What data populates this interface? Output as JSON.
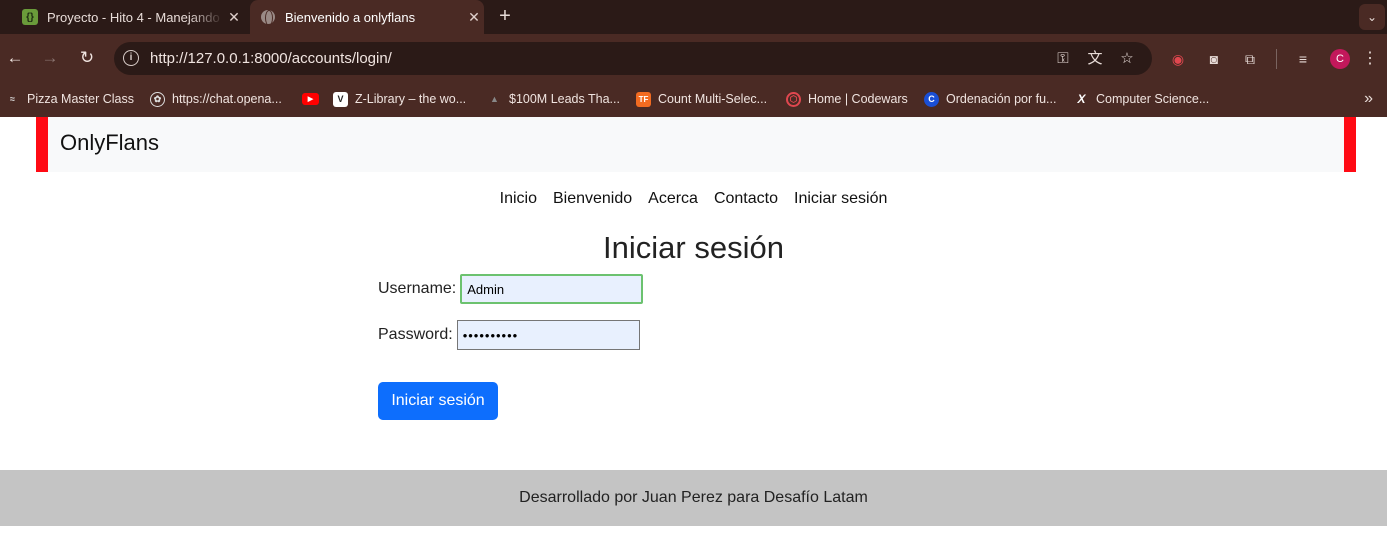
{
  "browser": {
    "tabs": [
      {
        "title": "Proyecto - Hito 4 - Manejando",
        "favicon": "{}",
        "active": false
      },
      {
        "title": "Bienvenido a onlyflans",
        "favicon": "globe-icon",
        "active": true
      }
    ],
    "url": "http://127.0.0.1:8000/accounts/login/",
    "bookmarks": [
      {
        "label": "Pizza Master Class",
        "icon": "pizza-icon"
      },
      {
        "label": "https://chat.opena...",
        "icon": "openai-icon"
      },
      {
        "label": "",
        "icon": "youtube-icon"
      },
      {
        "label": "Z-Library – the wo...",
        "icon": "zlibrary-icon"
      },
      {
        "label": "$100M Leads Tha...",
        "icon": "leads-icon"
      },
      {
        "label": "Count Multi-Selec...",
        "icon": "tf-icon"
      },
      {
        "label": "Home | Codewars",
        "icon": "codewars-icon"
      },
      {
        "label": "Ordenación por fu...",
        "icon": "c-icon"
      },
      {
        "label": "Computer Science...",
        "icon": "x-icon"
      }
    ],
    "profile_initial": "C"
  },
  "site": {
    "brand": "OnlyFlans",
    "nav": [
      "Inicio",
      "Bienvenido",
      "Acerca",
      "Contacto",
      "Iniciar sesión"
    ],
    "heading": "Iniciar sesión",
    "form": {
      "username_label": "Username:",
      "username_value": "Admin",
      "password_label": "Password:",
      "password_value": "••••••••••",
      "submit_label": "Iniciar sesión"
    },
    "footer": "Desarrollado por Juan Perez para Desafío Latam"
  },
  "colors": {
    "brand_border": "#ff0a14",
    "primary_button": "#0d6efd",
    "footer_bg": "#c4c4c4",
    "chrome_dark": "#2b1a17",
    "chrome_toolbar": "#4a2a24"
  }
}
